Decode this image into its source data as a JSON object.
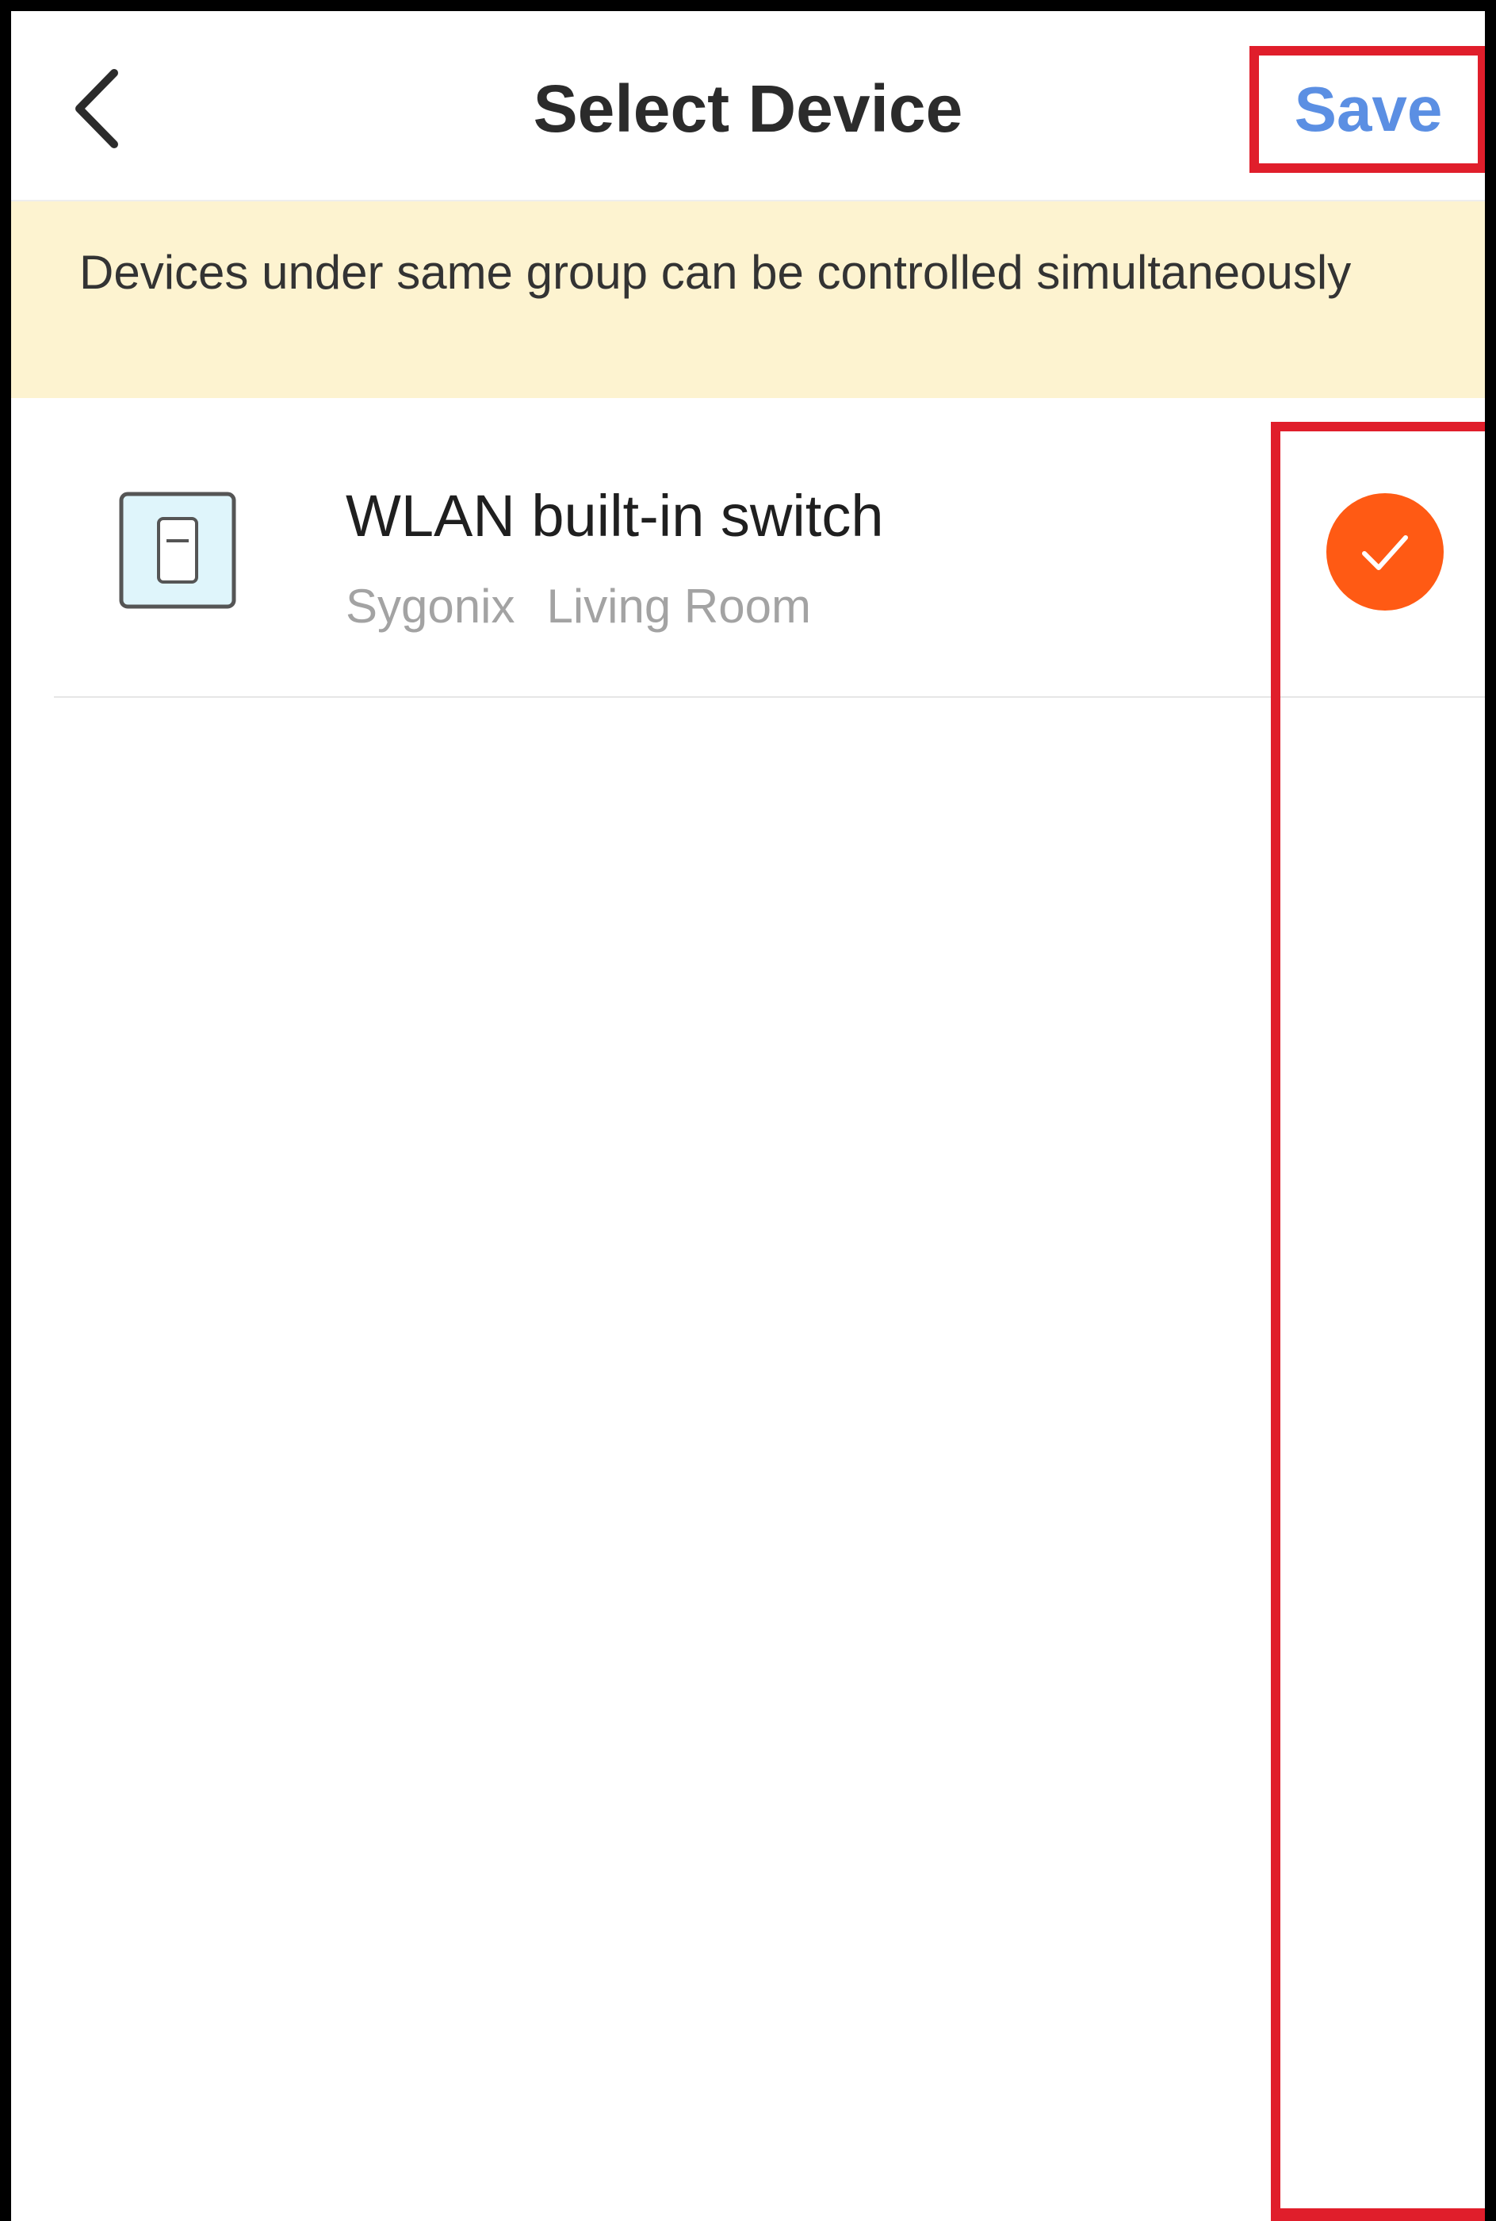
{
  "header": {
    "title": "Select Device",
    "save_label": "Save",
    "back_icon": "chevron-left-icon"
  },
  "banner": {
    "text": "Devices under same group can be controlled simultaneously"
  },
  "devices": [
    {
      "name": "WLAN built-in switch",
      "brand": "Sygonix",
      "room": "Living Room",
      "icon": "wall-switch-icon",
      "selected": true
    }
  ],
  "colors": {
    "accent_blue": "#5b8fe3",
    "check_orange": "#ff5a14",
    "banner_bg": "#fdf3d0",
    "highlight_red": "#e01e2b"
  }
}
